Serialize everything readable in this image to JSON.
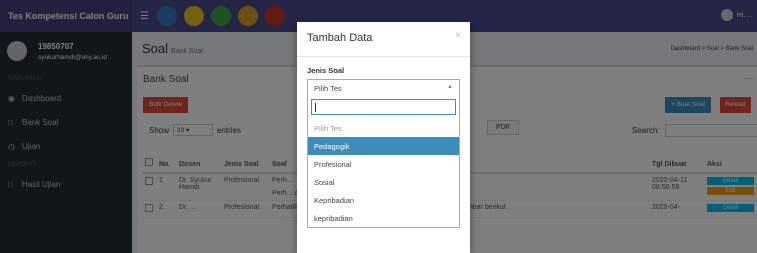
{
  "app": {
    "brand": "Tes Kompetensi Calon Guru",
    "user_short": "Hi, ..."
  },
  "sidebar": {
    "user": {
      "name": "19850707",
      "email": "syukurhamdi@uny.ac.id"
    },
    "section1": "MAIN MENU",
    "section2": "REPORTS",
    "items": [
      {
        "label": "Dashboard",
        "icon": "dashboard-icon"
      },
      {
        "label": "Bank Soal",
        "icon": "file-icon"
      },
      {
        "label": "Ujian",
        "icon": "clock-icon"
      },
      {
        "label": "Hasil Ujian",
        "icon": "file-icon"
      }
    ]
  },
  "page": {
    "title": "Soal",
    "subtitle": "Bank Soal",
    "breadcrumb": "Dashboard  >  Soal  >  Bank Soal",
    "box_title": "Bank Soal",
    "bulk_delete": "Bulk Delete",
    "add_button": "+ Buat Soal",
    "reload_button": "Reload",
    "show_label": "Show",
    "show_value": "10",
    "entries_label": "entries",
    "pdf_button": "PDF",
    "search_label": "Search:"
  },
  "table": {
    "headers": [
      "",
      "No.",
      "Dosen",
      "Jenis Soal",
      "Soal",
      "Tgl Dibuat",
      "Aksi"
    ],
    "rows": [
      {
        "no": "1",
        "dosen": "Dr. Syukur Hamdi",
        "jenis": "Profesional",
        "soal_line1": "Perh...",
        "soal_line2": "Perh...  di atas adalah ....",
        "tgl": "2020-04-11 08:56:59",
        "detail": "Detail",
        "edit": "Edit"
      },
      {
        "no": "2",
        "dosen": "Dr. ...",
        "jenis": "Profesional",
        "soal_line1": "Perhatikan persegipanjang ABCD dengan ketentuan seperti gambar berikut",
        "soal_line2": "",
        "tgl": "2020-04-",
        "detail": "Detail",
        "edit": ""
      }
    ]
  },
  "modal": {
    "title": "Tambah Data",
    "close": "×",
    "field_label": "Jenis Soal",
    "selected": "Pilih Tes",
    "options": [
      {
        "label": "Pilih Tes",
        "state": "disabled"
      },
      {
        "label": "Pedagogik",
        "state": "active"
      },
      {
        "label": "Profesional",
        "state": "normal"
      },
      {
        "label": "Sosial",
        "state": "normal"
      },
      {
        "label": "Kepribadian",
        "state": "normal"
      },
      {
        "label": "kepribadian",
        "state": "normal"
      }
    ]
  },
  "colors": {
    "header": "#4a4a8c",
    "sidebar": "#222d32",
    "primary": "#3c8dbc",
    "danger": "#dd4b39"
  }
}
